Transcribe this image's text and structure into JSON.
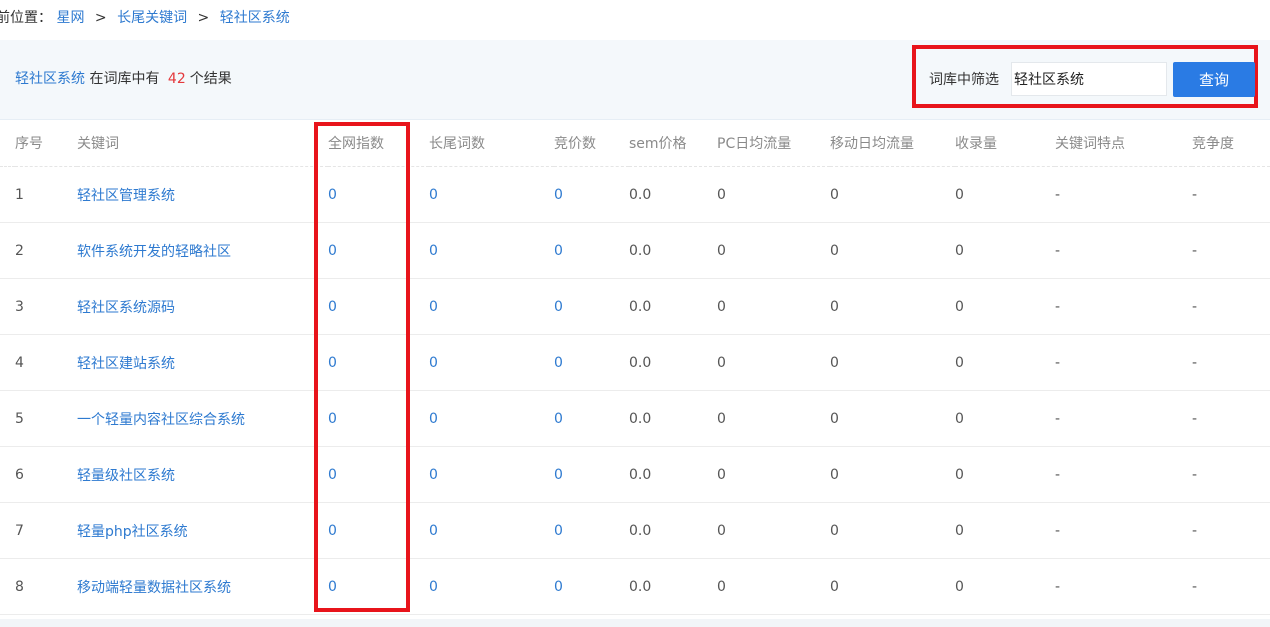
{
  "breadcrumb": {
    "prefix": "前位置：",
    "items": [
      "星网",
      "长尾关键词",
      "轻社区系统"
    ],
    "separator": ">"
  },
  "summary": {
    "keyword": "轻社区系统",
    "middle": "在词库中有",
    "count": "42",
    "suffix": "个结果"
  },
  "filter": {
    "label": "词库中筛选",
    "input_value": "轻社区系统",
    "button_label": "查询"
  },
  "table": {
    "headers": [
      "序号",
      "关键词",
      "全网指数",
      "长尾词数",
      "竞价数",
      "sem价格",
      "PC日均流量",
      "移动日均流量",
      "收录量",
      "关键词特点",
      "竞争度"
    ],
    "rows": [
      [
        "1",
        "轻社区管理系统",
        "0",
        "0",
        "0",
        "0.0",
        "0",
        "0",
        "0",
        "-",
        "-"
      ],
      [
        "2",
        "软件系统开发的轻略社区",
        "0",
        "0",
        "0",
        "0.0",
        "0",
        "0",
        "0",
        "-",
        "-"
      ],
      [
        "3",
        "轻社区系统源码",
        "0",
        "0",
        "0",
        "0.0",
        "0",
        "0",
        "0",
        "-",
        "-"
      ],
      [
        "4",
        "轻社区建站系统",
        "0",
        "0",
        "0",
        "0.0",
        "0",
        "0",
        "0",
        "-",
        "-"
      ],
      [
        "5",
        "一个轻量内容社区综合系统",
        "0",
        "0",
        "0",
        "0.0",
        "0",
        "0",
        "0",
        "-",
        "-"
      ],
      [
        "6",
        "轻量级社区系统",
        "0",
        "0",
        "0",
        "0.0",
        "0",
        "0",
        "0",
        "-",
        "-"
      ],
      [
        "7",
        "轻量php社区系统",
        "0",
        "0",
        "0",
        "0.0",
        "0",
        "0",
        "0",
        "-",
        "-"
      ],
      [
        "8",
        "移动端轻量数据社区系统",
        "0",
        "0",
        "0",
        "0.0",
        "0",
        "0",
        "0",
        "-",
        "-"
      ]
    ]
  },
  "colors": {
    "link": "#2e7ad0",
    "count": "#e4393c",
    "highlight_border": "#e8141b",
    "button": "#2a7be4",
    "summary_bg": "#f4f8fb"
  }
}
